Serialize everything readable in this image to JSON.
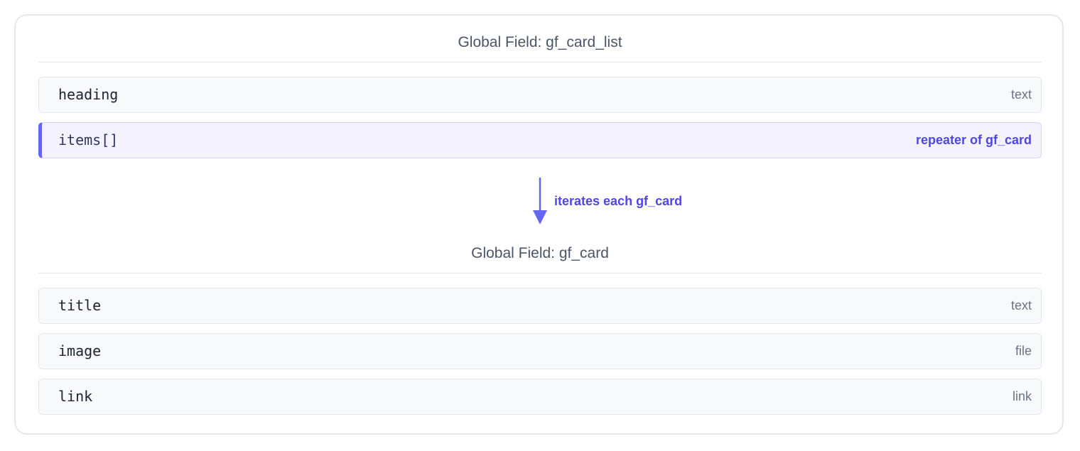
{
  "parent_field": {
    "title": "Global Field: gf_card_list",
    "fields": [
      {
        "name": "heading",
        "type": "text"
      },
      {
        "name": "items[]",
        "type": "repeater of gf_card"
      }
    ]
  },
  "relation": {
    "label": "iterates each gf_card",
    "accent_color": "#6466f1"
  },
  "child_field": {
    "title": "Global Field: gf_card",
    "fields": [
      {
        "name": "title",
        "type": "text"
      },
      {
        "name": "image",
        "type": "file"
      },
      {
        "name": "link",
        "type": "link"
      }
    ]
  }
}
